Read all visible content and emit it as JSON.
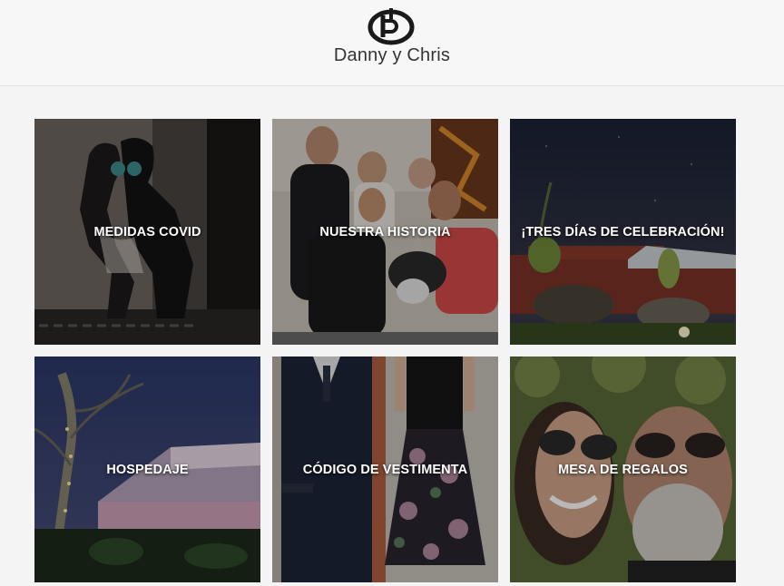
{
  "header": {
    "logo_name": "dc-monogram-logo",
    "title": "Danny y Chris"
  },
  "tiles": [
    {
      "label": "MEDIDAS COVID"
    },
    {
      "label": "NUESTRA HISTORIA"
    },
    {
      "label": "¡TRES DÍAS DE CELEBRACIÓN!"
    },
    {
      "label": "HOSPEDAJE"
    },
    {
      "label": "CÓDIGO DE VESTIMENTA"
    },
    {
      "label": "MESA DE REGALOS"
    }
  ]
}
